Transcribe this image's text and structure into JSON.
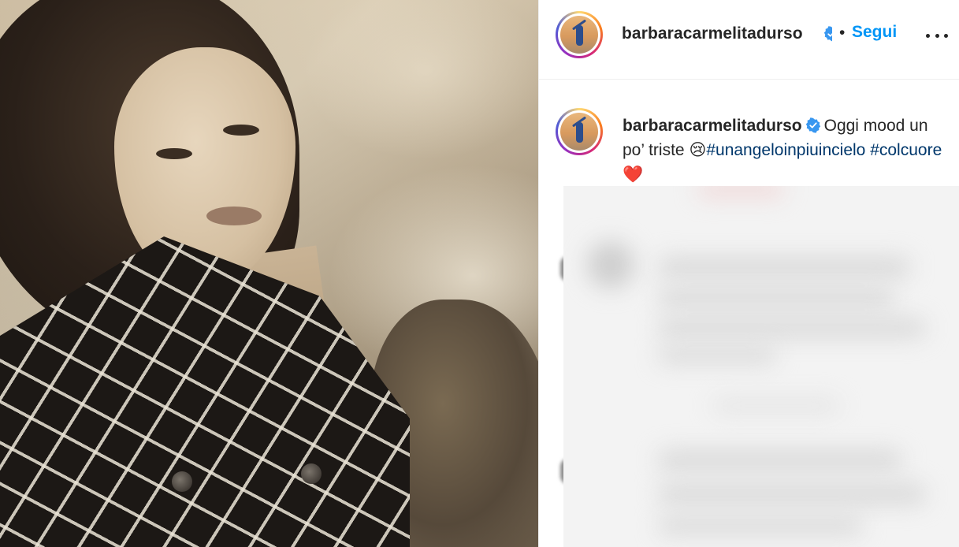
{
  "post": {
    "header": {
      "username": "barbaracarmelitadurso",
      "separator": "•",
      "follow_label": "Segui",
      "more_icon": "more-horizontal-icon"
    },
    "caption": {
      "username": "barbaracarmelitadurso",
      "text_before_emoji": "Oggi mood un po’ triste",
      "emoji": "😢",
      "hashtag_1": "#unangeloinpiuincielo",
      "hashtag_2": "#colcuore",
      "heart_emoji": "❤️"
    }
  },
  "colors": {
    "follow_blue": "#0095f6",
    "hashtag_blue": "#00376b",
    "verified_blue": "#3897f0",
    "text": "#262626"
  }
}
